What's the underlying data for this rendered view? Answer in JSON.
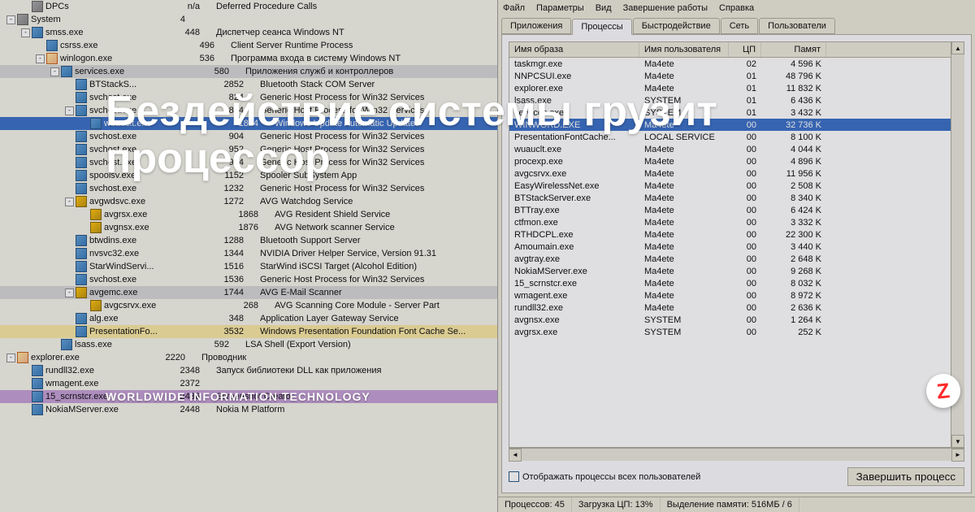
{
  "overlay": {
    "title_line1": "Бездействие системы грузит",
    "title_line2": "процессор",
    "subtitle": "WORLDWIDE INFORMATION TECHNOLOGY",
    "badge_letter": "Z"
  },
  "proctree": [
    {
      "indent": 1,
      "toggle": "",
      "icon": "sys",
      "name": "DPCs",
      "pid": "n/a",
      "desc": "Deferred Procedure Calls",
      "cls": ""
    },
    {
      "indent": 0,
      "toggle": "-",
      "icon": "sys",
      "name": "System",
      "pid": "4",
      "desc": "",
      "cls": ""
    },
    {
      "indent": 1,
      "toggle": "-",
      "icon": "app",
      "name": "smss.exe",
      "pid": "448",
      "desc": "Диспетчер сеанса Windows NT",
      "cls": ""
    },
    {
      "indent": 2,
      "toggle": "",
      "icon": "app",
      "name": "csrss.exe",
      "pid": "496",
      "desc": "Client Server Runtime Process",
      "cls": ""
    },
    {
      "indent": 2,
      "toggle": "-",
      "icon": "folder",
      "name": "winlogon.exe",
      "pid": "536",
      "desc": "Программа входа в систему Windows NT",
      "cls": ""
    },
    {
      "indent": 3,
      "toggle": "-",
      "icon": "app",
      "name": "services.exe",
      "pid": "580",
      "desc": "Приложения служб и контроллеров",
      "cls": "highlight-gray"
    },
    {
      "indent": 4,
      "toggle": "",
      "icon": "app",
      "name": "BTStackS...",
      "pid": "2852",
      "desc": "Bluetooth Stack COM Server",
      "cls": ""
    },
    {
      "indent": 4,
      "toggle": "",
      "icon": "app",
      "name": "svchost.exe",
      "pid": "824",
      "desc": "Generic Host Process for Win32 Services",
      "cls": ""
    },
    {
      "indent": 4,
      "toggle": "-",
      "icon": "app",
      "name": "svchost.exe",
      "pid": "864",
      "desc": "Generic Host Process for Win32 Services",
      "cls": ""
    },
    {
      "indent": 5,
      "toggle": "",
      "icon": "app",
      "name": "wuauclt.exe",
      "pid": "1824",
      "desc": "Windows Update Automatic Updates",
      "cls": "selected"
    },
    {
      "indent": 4,
      "toggle": "",
      "icon": "app",
      "name": "svchost.exe",
      "pid": "904",
      "desc": "Generic Host Process for Win32 Services",
      "cls": ""
    },
    {
      "indent": 4,
      "toggle": "",
      "icon": "app",
      "name": "svchost.exe",
      "pid": "952",
      "desc": "Generic Host Process for Win32 Services",
      "cls": ""
    },
    {
      "indent": 4,
      "toggle": "",
      "icon": "app",
      "name": "svchost.exe",
      "pid": "984",
      "desc": "Generic Host Process for Win32 Services",
      "cls": ""
    },
    {
      "indent": 4,
      "toggle": "",
      "icon": "app",
      "name": "spoolsv.exe",
      "pid": "1152",
      "desc": "Spooler SubSystem App",
      "cls": ""
    },
    {
      "indent": 4,
      "toggle": "",
      "icon": "app",
      "name": "svchost.exe",
      "pid": "1232",
      "desc": "Generic Host Process for Win32 Services",
      "cls": ""
    },
    {
      "indent": 4,
      "toggle": "-",
      "icon": "avg",
      "name": "avgwdsvc.exe",
      "pid": "1272",
      "desc": "AVG Watchdog Service",
      "cls": ""
    },
    {
      "indent": 5,
      "toggle": "",
      "icon": "avg",
      "name": "avgrsx.exe",
      "pid": "1868",
      "desc": "AVG Resident Shield Service",
      "cls": ""
    },
    {
      "indent": 5,
      "toggle": "",
      "icon": "avg",
      "name": "avgnsx.exe",
      "pid": "1876",
      "desc": "AVG Network scanner Service",
      "cls": ""
    },
    {
      "indent": 4,
      "toggle": "",
      "icon": "app",
      "name": "btwdins.exe",
      "pid": "1288",
      "desc": "Bluetooth Support Server",
      "cls": ""
    },
    {
      "indent": 4,
      "toggle": "",
      "icon": "app",
      "name": "nvsvc32.exe",
      "pid": "1344",
      "desc": "NVIDIA Driver Helper Service, Version 91.31",
      "cls": ""
    },
    {
      "indent": 4,
      "toggle": "",
      "icon": "app",
      "name": "StarWindServi...",
      "pid": "1516",
      "desc": "StarWind iSCSI Target (Alcohol Edition)",
      "cls": ""
    },
    {
      "indent": 4,
      "toggle": "",
      "icon": "app",
      "name": "svchost.exe",
      "pid": "1536",
      "desc": "Generic Host Process for Win32 Services",
      "cls": ""
    },
    {
      "indent": 4,
      "toggle": "-",
      "icon": "avg",
      "name": "avgemc.exe",
      "pid": "1744",
      "desc": "AVG E-Mail Scanner",
      "cls": "highlight-gray"
    },
    {
      "indent": 5,
      "toggle": "",
      "icon": "avg",
      "name": "avgcsrvx.exe",
      "pid": "268",
      "desc": "AVG Scanning Core Module - Server Part",
      "cls": ""
    },
    {
      "indent": 4,
      "toggle": "",
      "icon": "app",
      "name": "alg.exe",
      "pid": "348",
      "desc": "Application Layer Gateway Service",
      "cls": ""
    },
    {
      "indent": 4,
      "toggle": "",
      "icon": "app",
      "name": "PresentationFo...",
      "pid": "3532",
      "desc": "Windows Presentation Foundation Font Cache Se...",
      "cls": "highlight-yellow"
    },
    {
      "indent": 3,
      "toggle": "",
      "icon": "app",
      "name": "lsass.exe",
      "pid": "592",
      "desc": "LSA Shell (Export Version)",
      "cls": ""
    },
    {
      "indent": 0,
      "toggle": "-",
      "icon": "folder",
      "name": "explorer.exe",
      "pid": "2220",
      "desc": "Проводник",
      "cls": ""
    },
    {
      "indent": 1,
      "toggle": "",
      "icon": "app",
      "name": "rundll32.exe",
      "pid": "2348",
      "desc": "Запуск библиотеки DLL как приложения",
      "cls": ""
    },
    {
      "indent": 1,
      "toggle": "",
      "icon": "app",
      "name": "wmagent.exe",
      "pid": "2372",
      "desc": "",
      "cls": ""
    },
    {
      "indent": 1,
      "toggle": "",
      "icon": "app",
      "name": "15_scrnstcr.exe",
      "pid": "2436",
      "desc": "Screenshot Creator",
      "cls": "highlight-purple"
    },
    {
      "indent": 1,
      "toggle": "",
      "icon": "app",
      "name": "NokiaMServer.exe",
      "pid": "2448",
      "desc": "Nokia M Platform",
      "cls": ""
    }
  ],
  "taskmgr": {
    "menus": [
      "Файл",
      "Параметры",
      "Вид",
      "Завершение работы",
      "Справка"
    ],
    "tabs": [
      "Приложения",
      "Процессы",
      "Быстродействие",
      "Сеть",
      "Пользователи"
    ],
    "active_tab": 1,
    "columns": {
      "image": "Имя образа",
      "user": "Имя пользователя",
      "cpu": "ЦП",
      "mem": "Памят"
    },
    "processes": [
      {
        "img": "taskmgr.exe",
        "user": "Ma4ete",
        "cpu": "02",
        "mem": "4 596 K",
        "sel": false
      },
      {
        "img": "NNPCSUI.exe",
        "user": "Ma4ete",
        "cpu": "01",
        "mem": "48 796 K",
        "sel": false
      },
      {
        "img": "explorer.exe",
        "user": "Ma4ete",
        "cpu": "01",
        "mem": "11 832 K",
        "sel": false
      },
      {
        "img": "lsass.exe",
        "user": "SYSTEM",
        "cpu": "01",
        "mem": "6 436 K",
        "sel": false
      },
      {
        "img": "services.exe",
        "user": "SYSTEM",
        "cpu": "01",
        "mem": "3 432 K",
        "sel": false
      },
      {
        "img": "WINWORD.EXE",
        "user": "Ma4ete",
        "cpu": "00",
        "mem": "32 736 K",
        "sel": true
      },
      {
        "img": "PresentationFontCache...",
        "user": "LOCAL SERVICE",
        "cpu": "00",
        "mem": "8 100 K",
        "sel": false
      },
      {
        "img": "wuauclt.exe",
        "user": "Ma4ete",
        "cpu": "00",
        "mem": "4 044 K",
        "sel": false
      },
      {
        "img": "procexp.exe",
        "user": "Ma4ete",
        "cpu": "00",
        "mem": "4 896 K",
        "sel": false
      },
      {
        "img": "avgcsrvx.exe",
        "user": "Ma4ete",
        "cpu": "00",
        "mem": "11 956 K",
        "sel": false
      },
      {
        "img": "EasyWirelessNet.exe",
        "user": "Ma4ete",
        "cpu": "00",
        "mem": "2 508 K",
        "sel": false
      },
      {
        "img": "BTStackServer.exe",
        "user": "Ma4ete",
        "cpu": "00",
        "mem": "8 340 K",
        "sel": false
      },
      {
        "img": "BTTray.exe",
        "user": "Ma4ete",
        "cpu": "00",
        "mem": "6 424 K",
        "sel": false
      },
      {
        "img": "ctfmon.exe",
        "user": "Ma4ete",
        "cpu": "00",
        "mem": "3 332 K",
        "sel": false
      },
      {
        "img": "RTHDCPL.exe",
        "user": "Ma4ete",
        "cpu": "00",
        "mem": "22 300 K",
        "sel": false
      },
      {
        "img": "Amoumain.exe",
        "user": "Ma4ete",
        "cpu": "00",
        "mem": "3 440 K",
        "sel": false
      },
      {
        "img": "avgtray.exe",
        "user": "Ma4ete",
        "cpu": "00",
        "mem": "2 648 K",
        "sel": false
      },
      {
        "img": "NokiaMServer.exe",
        "user": "Ma4ete",
        "cpu": "00",
        "mem": "9 268 K",
        "sel": false
      },
      {
        "img": "15_scrnstcr.exe",
        "user": "Ma4ete",
        "cpu": "00",
        "mem": "8 032 K",
        "sel": false
      },
      {
        "img": "wmagent.exe",
        "user": "Ma4ete",
        "cpu": "00",
        "mem": "8 972 K",
        "sel": false
      },
      {
        "img": "rundll32.exe",
        "user": "Ma4ete",
        "cpu": "00",
        "mem": "2 636 K",
        "sel": false
      },
      {
        "img": "avgnsx.exe",
        "user": "SYSTEM",
        "cpu": "00",
        "mem": "1 264 K",
        "sel": false
      },
      {
        "img": "avgrsx.exe",
        "user": "SYSTEM",
        "cpu": "00",
        "mem": "252 K",
        "sel": false
      }
    ],
    "checkbox_label": "Отображать процессы всех пользователей",
    "end_button": "Завершить процесс",
    "status": {
      "procs": "Процессов: 45",
      "cpu": "Загрузка ЦП: 13%",
      "mem": "Выделение памяти: 516МБ / 6"
    }
  }
}
